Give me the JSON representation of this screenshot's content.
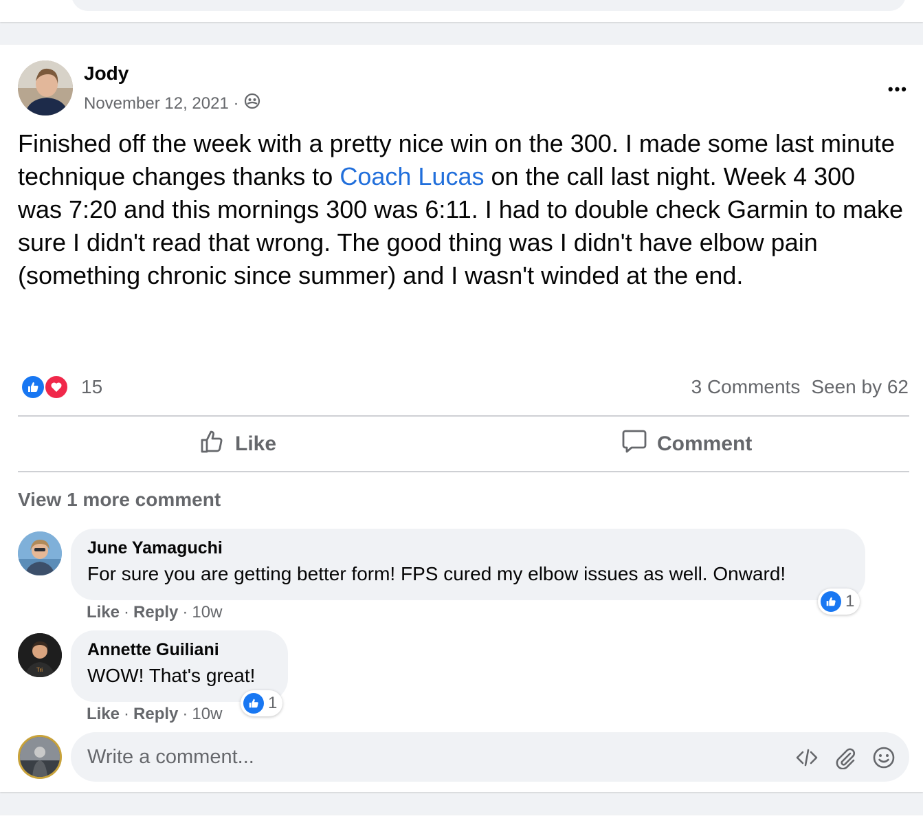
{
  "post": {
    "author": "Jody",
    "date": "November 12, 2021 ·",
    "more_label": "•••",
    "body": {
      "part1": "Finished off the week with a pretty nice win on the 300. I made some last minute technique changes thanks to ",
      "mention": "Coach Lucas",
      "part2": " on the call last night. Week 4 300 was 7:20 and this mornings 300 was 6:11. I had to double check Garmin to make sure I didn't read that wrong. The good thing was I didn't have elbow pain (something chronic since summer) and I wasn't winded at the end."
    },
    "reaction_count": "15",
    "comments_count": "3 Comments",
    "seen_by": "Seen by 62",
    "actions": {
      "like": "Like",
      "comment": "Comment"
    }
  },
  "comments_section": {
    "view_more": "View 1 more comment",
    "comments": [
      {
        "name": "June Yamaguchi",
        "text": "For sure you are getting better form! FPS cured my elbow issues as well. Onward!",
        "like": "Like",
        "reply": "Reply",
        "time": "10w",
        "reactions": "1"
      },
      {
        "name": "Annette Guiliani",
        "text": "WOW! That's great!",
        "like": "Like",
        "reply": "Reply",
        "time": "10w",
        "reactions": "1"
      }
    ],
    "write_placeholder": "Write a comment..."
  },
  "colors": {
    "accent": "#1877f2",
    "mention": "#216fdb",
    "love": "#f0284a",
    "secondary_text": "#65676b",
    "bubble_bg": "#f0f2f5"
  },
  "icons": [
    "group-members-icon",
    "more-icon",
    "like-reaction-icon",
    "love-reaction-icon",
    "thumbs-up-outline-icon",
    "comment-bubble-icon",
    "code-icon",
    "paperclip-icon",
    "emoji-icon"
  ]
}
